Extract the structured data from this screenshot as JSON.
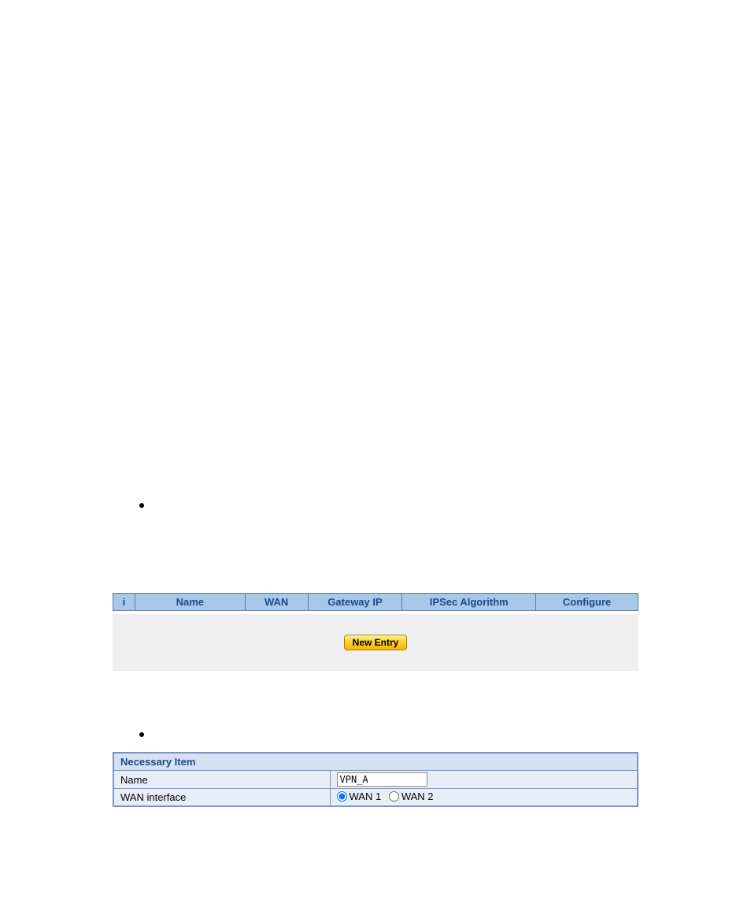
{
  "table1": {
    "headers": {
      "i": "i",
      "name": "Name",
      "wan": "WAN",
      "gateway": "Gateway IP",
      "algo": "IPSec Algorithm",
      "configure": "Configure"
    },
    "button": "New Entry"
  },
  "table2": {
    "section_header": "Necessary Item",
    "name_label": "Name",
    "name_value": "VPN_A",
    "wan_label": "WAN interface",
    "wan1_label": "WAN 1",
    "wan2_label": "WAN 2",
    "wan_selected": "WAN 1"
  }
}
